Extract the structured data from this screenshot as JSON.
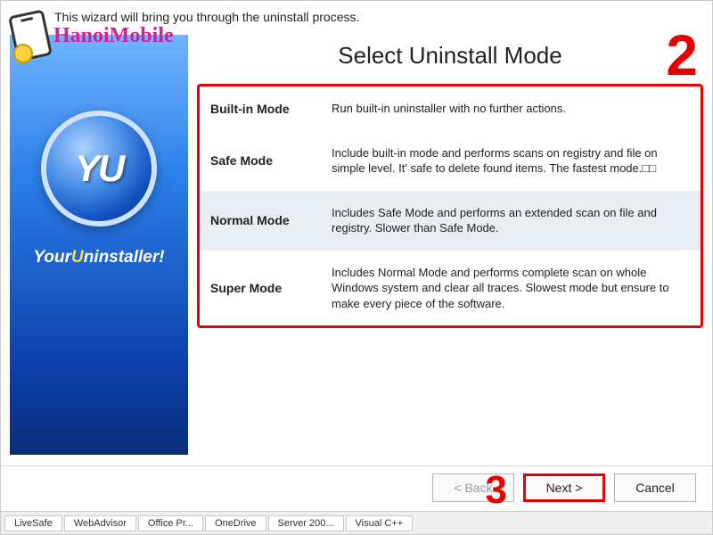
{
  "watermark": "HanoiMobile",
  "intro": "This wizard will bring you through the uninstall process.",
  "title": "Select Uninstall Mode",
  "step_mode": "2",
  "step_next": "3",
  "sidebar": {
    "logo_text": "YU",
    "brand_prefix": "Your",
    "brand_mid": "U",
    "brand_suffix": "ninstaller!"
  },
  "modes": [
    {
      "name": "Built-in Mode",
      "desc": "Run built-in uninstaller with no further actions.",
      "selected": false
    },
    {
      "name": "Safe Mode",
      "desc": "Include built-in mode and performs scans on registry and file on simple level. It' safe to delete found items. The fastest mode.□□",
      "selected": false
    },
    {
      "name": "Normal Mode",
      "desc": "Includes Safe Mode and performs an extended scan on file and registry. Slower than Safe Mode.",
      "selected": true
    },
    {
      "name": "Super Mode",
      "desc": "Includes Normal Mode and performs complete scan on whole Windows system and clear all traces. Slowest mode but ensure to make every piece of the software.",
      "selected": false
    }
  ],
  "buttons": {
    "back": "< Back",
    "next": "Next >",
    "cancel": "Cancel"
  },
  "taskbar": [
    "LiveSafe",
    "WebAdvisor",
    "Office Pr...",
    "OneDrive",
    "Server 200...",
    "Visual C++"
  ]
}
